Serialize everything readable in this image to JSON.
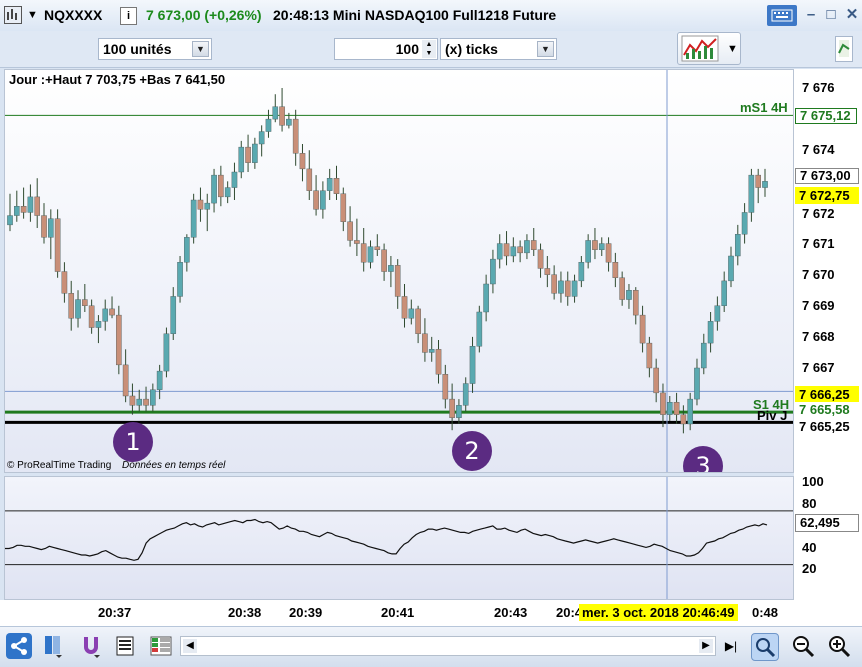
{
  "window": {
    "symbol": "NQXXXX",
    "price_info": "7 673,00 (+0,26%)",
    "time_info": "20:48:13 Mini NASDAQ100 Full1218 Future"
  },
  "toolbar": {
    "quantity": "100 unités",
    "period_value": "100",
    "period_unit": "(x) ticks"
  },
  "chart": {
    "header": "Jour :+Haut 7 703,75 +Bas 7 641,50",
    "footer_brand": "© ProRealTime Trading",
    "footer_note": "Données en temps réel",
    "levels": {
      "ms1_4h": {
        "label": "mS1 4H",
        "value": "7 675,12"
      },
      "s1_4h": {
        "label": "S1 4H",
        "value": "7 665,58"
      },
      "piv_j": {
        "label": "Piv J",
        "value": "7 665,25"
      },
      "cursor_price": "7 666,25",
      "current_bid": "7 673,00",
      "current_last": "7 672,75"
    },
    "price_axis": [
      "7 676",
      "7 674",
      "7 673",
      "7 672",
      "7 671",
      "7 670",
      "7 669",
      "7 668",
      "7 667"
    ],
    "indicator_axis": [
      "100",
      "80",
      "40",
      "20"
    ],
    "indicator_value": "62,495",
    "time_axis": [
      "20:37",
      "20:38",
      "20:39",
      "20:41",
      "20:43",
      "20:4",
      "0:48"
    ],
    "crosshair_time": "mer. 3 oct. 2018 20:46:49",
    "markers": [
      "1",
      "2",
      "3"
    ],
    "colors": {
      "up": "#5aa9b0",
      "down": "#c98f78",
      "support": "#1f7a1f",
      "pivot": "#000000",
      "crosshair": "#7f9bd0",
      "marker": "#5b2b82"
    }
  },
  "chart_data": {
    "type": "candlestick",
    "ylim": [
      7665.0,
      7676.25
    ],
    "candles": [
      {
        "o": 7671.6,
        "h": 7672.6,
        "l": 7671.4,
        "c": 7671.9
      },
      {
        "o": 7671.9,
        "h": 7672.7,
        "l": 7671.7,
        "c": 7672.2
      },
      {
        "o": 7672.2,
        "h": 7672.8,
        "l": 7671.8,
        "c": 7672.0
      },
      {
        "o": 7672.0,
        "h": 7672.9,
        "l": 7671.7,
        "c": 7672.5
      },
      {
        "o": 7672.5,
        "h": 7673.1,
        "l": 7671.5,
        "c": 7671.9
      },
      {
        "o": 7671.9,
        "h": 7672.3,
        "l": 7671.0,
        "c": 7671.2
      },
      {
        "o": 7671.2,
        "h": 7672.1,
        "l": 7670.5,
        "c": 7671.8
      },
      {
        "o": 7671.8,
        "h": 7672.1,
        "l": 7669.9,
        "c": 7670.1
      },
      {
        "o": 7670.1,
        "h": 7670.4,
        "l": 7669.1,
        "c": 7669.4
      },
      {
        "o": 7669.4,
        "h": 7669.8,
        "l": 7668.2,
        "c": 7668.6
      },
      {
        "o": 7668.6,
        "h": 7669.5,
        "l": 7668.3,
        "c": 7669.2
      },
      {
        "o": 7669.2,
        "h": 7669.7,
        "l": 7668.8,
        "c": 7669.0
      },
      {
        "o": 7669.0,
        "h": 7669.2,
        "l": 7668.1,
        "c": 7668.3
      },
      {
        "o": 7668.3,
        "h": 7668.7,
        "l": 7667.8,
        "c": 7668.5
      },
      {
        "o": 7668.5,
        "h": 7669.2,
        "l": 7668.2,
        "c": 7668.9
      },
      {
        "o": 7668.9,
        "h": 7669.3,
        "l": 7668.6,
        "c": 7668.7
      },
      {
        "o": 7668.7,
        "h": 7669.0,
        "l": 7666.8,
        "c": 7667.1
      },
      {
        "o": 7667.1,
        "h": 7667.6,
        "l": 7665.9,
        "c": 7666.1
      },
      {
        "o": 7666.1,
        "h": 7666.5,
        "l": 7665.5,
        "c": 7665.8
      },
      {
        "o": 7665.8,
        "h": 7666.3,
        "l": 7665.6,
        "c": 7666.0
      },
      {
        "o": 7666.0,
        "h": 7666.4,
        "l": 7665.6,
        "c": 7665.8
      },
      {
        "o": 7665.8,
        "h": 7666.5,
        "l": 7665.6,
        "c": 7666.3
      },
      {
        "o": 7666.3,
        "h": 7667.1,
        "l": 7666.0,
        "c": 7666.9
      },
      {
        "o": 7666.9,
        "h": 7668.3,
        "l": 7666.7,
        "c": 7668.1
      },
      {
        "o": 7668.1,
        "h": 7669.6,
        "l": 7667.9,
        "c": 7669.3
      },
      {
        "o": 7669.3,
        "h": 7670.6,
        "l": 7669.1,
        "c": 7670.4
      },
      {
        "o": 7670.4,
        "h": 7671.3,
        "l": 7670.1,
        "c": 7671.2
      },
      {
        "o": 7671.2,
        "h": 7672.6,
        "l": 7671.0,
        "c": 7672.4
      },
      {
        "o": 7672.4,
        "h": 7672.8,
        "l": 7671.7,
        "c": 7672.1
      },
      {
        "o": 7672.1,
        "h": 7672.6,
        "l": 7671.4,
        "c": 7672.3
      },
      {
        "o": 7672.3,
        "h": 7673.4,
        "l": 7672.0,
        "c": 7673.2
      },
      {
        "o": 7673.2,
        "h": 7673.5,
        "l": 7672.2,
        "c": 7672.5
      },
      {
        "o": 7672.5,
        "h": 7673.0,
        "l": 7672.3,
        "c": 7672.8
      },
      {
        "o": 7672.8,
        "h": 7673.6,
        "l": 7672.4,
        "c": 7673.3
      },
      {
        "o": 7673.3,
        "h": 7674.3,
        "l": 7673.1,
        "c": 7674.1
      },
      {
        "o": 7674.1,
        "h": 7674.5,
        "l": 7673.3,
        "c": 7673.6
      },
      {
        "o": 7673.6,
        "h": 7674.4,
        "l": 7673.4,
        "c": 7674.2
      },
      {
        "o": 7674.2,
        "h": 7674.8,
        "l": 7673.8,
        "c": 7674.6
      },
      {
        "o": 7674.6,
        "h": 7675.3,
        "l": 7674.4,
        "c": 7675.0
      },
      {
        "o": 7675.0,
        "h": 7675.8,
        "l": 7674.9,
        "c": 7675.4
      },
      {
        "o": 7675.4,
        "h": 7676.0,
        "l": 7674.6,
        "c": 7674.8
      },
      {
        "o": 7674.8,
        "h": 7675.2,
        "l": 7674.7,
        "c": 7675.0
      },
      {
        "o": 7675.0,
        "h": 7675.3,
        "l": 7673.5,
        "c": 7673.9
      },
      {
        "o": 7673.9,
        "h": 7674.2,
        "l": 7673.0,
        "c": 7673.4
      },
      {
        "o": 7673.4,
        "h": 7674.0,
        "l": 7672.4,
        "c": 7672.7
      },
      {
        "o": 7672.7,
        "h": 7673.2,
        "l": 7671.9,
        "c": 7672.1
      },
      {
        "o": 7672.1,
        "h": 7673.0,
        "l": 7671.8,
        "c": 7672.7
      },
      {
        "o": 7672.7,
        "h": 7673.4,
        "l": 7672.4,
        "c": 7673.1
      },
      {
        "o": 7673.1,
        "h": 7673.5,
        "l": 7672.4,
        "c": 7672.6
      },
      {
        "o": 7672.6,
        "h": 7672.8,
        "l": 7671.4,
        "c": 7671.7
      },
      {
        "o": 7671.7,
        "h": 7672.2,
        "l": 7670.9,
        "c": 7671.1
      },
      {
        "o": 7671.1,
        "h": 7671.8,
        "l": 7670.6,
        "c": 7671.0
      },
      {
        "o": 7671.0,
        "h": 7671.5,
        "l": 7670.1,
        "c": 7670.4
      },
      {
        "o": 7670.4,
        "h": 7671.1,
        "l": 7670.2,
        "c": 7670.9
      },
      {
        "o": 7670.9,
        "h": 7671.3,
        "l": 7670.6,
        "c": 7670.8
      },
      {
        "o": 7670.8,
        "h": 7671.0,
        "l": 7669.8,
        "c": 7670.1
      },
      {
        "o": 7670.1,
        "h": 7670.6,
        "l": 7669.6,
        "c": 7670.3
      },
      {
        "o": 7670.3,
        "h": 7670.5,
        "l": 7668.9,
        "c": 7669.3
      },
      {
        "o": 7669.3,
        "h": 7669.7,
        "l": 7668.3,
        "c": 7668.6
      },
      {
        "o": 7668.6,
        "h": 7669.2,
        "l": 7668.4,
        "c": 7668.9
      },
      {
        "o": 7668.9,
        "h": 7669.0,
        "l": 7667.8,
        "c": 7668.1
      },
      {
        "o": 7668.1,
        "h": 7668.6,
        "l": 7667.2,
        "c": 7667.5
      },
      {
        "o": 7667.5,
        "h": 7668.0,
        "l": 7667.2,
        "c": 7667.6
      },
      {
        "o": 7667.6,
        "h": 7667.9,
        "l": 7666.5,
        "c": 7666.8
      },
      {
        "o": 7666.8,
        "h": 7667.1,
        "l": 7665.7,
        "c": 7666.0
      },
      {
        "o": 7666.0,
        "h": 7666.5,
        "l": 7665.0,
        "c": 7665.4
      },
      {
        "o": 7665.4,
        "h": 7666.0,
        "l": 7665.2,
        "c": 7665.8
      },
      {
        "o": 7665.8,
        "h": 7666.7,
        "l": 7665.6,
        "c": 7666.5
      },
      {
        "o": 7666.5,
        "h": 7668.0,
        "l": 7666.2,
        "c": 7667.7
      },
      {
        "o": 7667.7,
        "h": 7669.0,
        "l": 7667.5,
        "c": 7668.8
      },
      {
        "o": 7668.8,
        "h": 7670.0,
        "l": 7668.5,
        "c": 7669.7
      },
      {
        "o": 7669.7,
        "h": 7670.8,
        "l": 7669.4,
        "c": 7670.5
      },
      {
        "o": 7670.5,
        "h": 7671.3,
        "l": 7670.2,
        "c": 7671.0
      },
      {
        "o": 7671.0,
        "h": 7671.4,
        "l": 7670.3,
        "c": 7670.6
      },
      {
        "o": 7670.6,
        "h": 7671.2,
        "l": 7670.4,
        "c": 7670.9
      },
      {
        "o": 7670.9,
        "h": 7671.1,
        "l": 7670.4,
        "c": 7670.7
      },
      {
        "o": 7670.7,
        "h": 7671.3,
        "l": 7670.5,
        "c": 7671.1
      },
      {
        "o": 7671.1,
        "h": 7671.5,
        "l": 7670.6,
        "c": 7670.8
      },
      {
        "o": 7670.8,
        "h": 7671.0,
        "l": 7669.9,
        "c": 7670.2
      },
      {
        "o": 7670.2,
        "h": 7670.6,
        "l": 7669.6,
        "c": 7670.0
      },
      {
        "o": 7670.0,
        "h": 7670.3,
        "l": 7669.2,
        "c": 7669.4
      },
      {
        "o": 7669.4,
        "h": 7670.1,
        "l": 7669.1,
        "c": 7669.8
      },
      {
        "o": 7669.8,
        "h": 7670.1,
        "l": 7669.0,
        "c": 7669.3
      },
      {
        "o": 7669.3,
        "h": 7670.0,
        "l": 7669.1,
        "c": 7669.8
      },
      {
        "o": 7669.8,
        "h": 7670.6,
        "l": 7669.6,
        "c": 7670.4
      },
      {
        "o": 7670.4,
        "h": 7671.3,
        "l": 7670.2,
        "c": 7671.1
      },
      {
        "o": 7671.1,
        "h": 7671.5,
        "l": 7670.5,
        "c": 7670.8
      },
      {
        "o": 7670.8,
        "h": 7671.2,
        "l": 7670.6,
        "c": 7671.0
      },
      {
        "o": 7671.0,
        "h": 7671.2,
        "l": 7670.1,
        "c": 7670.4
      },
      {
        "o": 7670.4,
        "h": 7670.7,
        "l": 7669.6,
        "c": 7669.9
      },
      {
        "o": 7669.9,
        "h": 7670.1,
        "l": 7669.0,
        "c": 7669.2
      },
      {
        "o": 7669.2,
        "h": 7669.7,
        "l": 7668.9,
        "c": 7669.5
      },
      {
        "o": 7669.5,
        "h": 7669.6,
        "l": 7668.4,
        "c": 7668.7
      },
      {
        "o": 7668.7,
        "h": 7669.0,
        "l": 7667.5,
        "c": 7667.8
      },
      {
        "o": 7667.8,
        "h": 7668.0,
        "l": 7666.7,
        "c": 7667.0
      },
      {
        "o": 7667.0,
        "h": 7667.3,
        "l": 7665.9,
        "c": 7666.2
      },
      {
        "o": 7666.2,
        "h": 7666.5,
        "l": 7665.1,
        "c": 7665.5
      },
      {
        "o": 7665.5,
        "h": 7666.1,
        "l": 7665.3,
        "c": 7665.9
      },
      {
        "o": 7665.9,
        "h": 7666.2,
        "l": 7665.2,
        "c": 7665.5
      },
      {
        "o": 7665.5,
        "h": 7665.8,
        "l": 7664.9,
        "c": 7665.2
      },
      {
        "o": 7665.2,
        "h": 7666.2,
        "l": 7665.0,
        "c": 7666.0
      },
      {
        "o": 7666.0,
        "h": 7667.3,
        "l": 7665.8,
        "c": 7667.0
      },
      {
        "o": 7667.0,
        "h": 7668.1,
        "l": 7666.8,
        "c": 7667.8
      },
      {
        "o": 7667.8,
        "h": 7668.8,
        "l": 7667.5,
        "c": 7668.5
      },
      {
        "o": 7668.5,
        "h": 7669.3,
        "l": 7668.2,
        "c": 7669.0
      },
      {
        "o": 7669.0,
        "h": 7670.1,
        "l": 7668.8,
        "c": 7669.8
      },
      {
        "o": 7669.8,
        "h": 7670.9,
        "l": 7669.6,
        "c": 7670.6
      },
      {
        "o": 7670.6,
        "h": 7671.6,
        "l": 7670.3,
        "c": 7671.3
      },
      {
        "o": 7671.3,
        "h": 7672.3,
        "l": 7671.0,
        "c": 7672.0
      },
      {
        "o": 7672.0,
        "h": 7673.4,
        "l": 7671.7,
        "c": 7673.2
      },
      {
        "o": 7673.2,
        "h": 7673.4,
        "l": 7672.3,
        "c": 7672.8
      },
      {
        "o": 7672.8,
        "h": 7673.4,
        "l": 7672.5,
        "c": 7673.0
      }
    ],
    "indicator": {
      "ylim": [
        0,
        112
      ],
      "upper_band": 75,
      "lower_band": 25,
      "values": [
        40,
        40,
        41,
        43,
        43,
        42,
        42,
        41,
        40,
        39,
        40,
        42,
        41,
        40,
        39,
        38,
        37,
        36,
        35,
        34,
        34,
        33,
        34,
        35,
        37,
        38,
        36,
        34,
        32,
        31,
        31,
        30,
        29,
        30,
        36,
        45,
        49,
        51,
        53,
        55,
        57,
        58,
        59,
        61,
        63,
        64,
        62,
        63,
        61,
        60,
        62,
        63,
        64,
        62,
        63,
        64,
        65,
        66,
        65,
        64,
        66,
        66,
        67,
        65,
        64,
        65,
        64,
        61,
        58,
        59,
        61,
        59,
        58,
        56,
        56,
        55,
        53,
        52,
        51,
        53,
        55,
        54,
        52,
        51,
        50,
        49,
        47,
        46,
        45,
        44,
        42,
        41,
        40,
        39,
        38,
        36,
        35,
        35,
        40,
        44,
        46,
        50,
        53,
        55,
        56,
        58,
        58,
        57,
        58,
        59,
        58,
        57,
        56,
        55,
        55,
        54,
        56,
        57,
        58,
        59,
        60,
        61,
        58,
        58,
        59,
        57,
        56,
        55,
        57,
        58,
        56,
        54,
        53,
        52,
        53,
        52,
        51,
        49,
        48,
        47,
        46,
        45,
        46,
        47,
        48,
        47,
        46,
        45,
        46,
        47,
        48,
        49,
        48,
        47,
        46,
        45,
        44,
        43,
        42,
        41,
        42,
        44,
        43,
        42,
        40,
        38,
        37,
        36,
        35,
        33,
        33,
        34,
        36,
        40,
        45,
        46,
        47,
        49,
        50,
        52,
        54,
        55,
        57,
        58,
        60,
        61,
        62,
        61,
        63,
        62
      ]
    }
  }
}
